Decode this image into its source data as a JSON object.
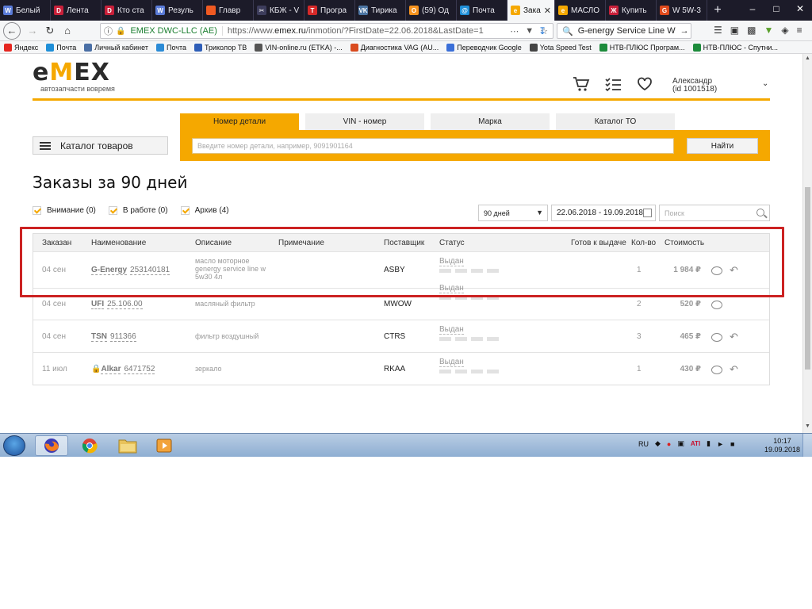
{
  "browser": {
    "tabs": [
      {
        "label": "Белый",
        "color": "#5a7bd8",
        "glyph": "W"
      },
      {
        "label": "Лента",
        "color": "#c8203a",
        "glyph": "D"
      },
      {
        "label": "Кто ста",
        "color": "#c8203a",
        "glyph": "D"
      },
      {
        "label": "Резуль",
        "color": "#5a7bd8",
        "glyph": "W"
      },
      {
        "label": "Главр",
        "color": "#f05a22",
        "glyph": ""
      },
      {
        "label": "КБЖ - V",
        "color": "#3d3d5c",
        "glyph": "✂"
      },
      {
        "label": "Програ",
        "color": "#d62929",
        "glyph": "T"
      },
      {
        "label": "Тирика",
        "color": "#4c75a3",
        "glyph": "VK"
      },
      {
        "label": "(59) Од",
        "color": "#f7931e",
        "glyph": "O"
      },
      {
        "label": "Почта",
        "color": "#1f8fd8",
        "glyph": "@"
      },
      {
        "label": "Заказ",
        "color": "#f5a800",
        "glyph": "e",
        "active": true
      },
      {
        "label": "МАСЛО",
        "color": "#f5a800",
        "glyph": "e"
      },
      {
        "label": "Купить",
        "color": "#c8203a",
        "glyph": "Ж"
      },
      {
        "label": "W 5W-3",
        "color": "#e04a1c",
        "glyph": "G"
      }
    ],
    "new_tab": "+",
    "url": {
      "site_label": "EMEX DWC-LLC (AE)",
      "prefix": "https://www.",
      "domain": "emex.ru",
      "path": "/inmotion/?FirstDate=22.06.2018&LastDate=1"
    },
    "search_value": "G-energy Service Line W",
    "bookmarks": [
      {
        "label": "Яндекс",
        "color": "#e52620"
      },
      {
        "label": "Почта",
        "color": "#1f8fd8"
      },
      {
        "label": "Личный кабинет",
        "color": "#4a6fa5"
      },
      {
        "label": "Почта",
        "color": "#2b8bd6"
      },
      {
        "label": "Триколор ТВ",
        "color": "#2e5eb8"
      },
      {
        "label": "VIN-online.ru (ETKA) -...",
        "color": "#555"
      },
      {
        "label": "Диагностика VAG (AU...",
        "color": "#d94a1e"
      },
      {
        "label": "Переводчик Google",
        "color": "#3a6fd8"
      },
      {
        "label": "Yota Speed Test",
        "color": "#444"
      },
      {
        "label": "НТВ-ПЛЮС Програм...",
        "color": "#1c8b3b"
      },
      {
        "label": "НТВ-ПЛЮС - Спутни...",
        "color": "#1c8b3b"
      }
    ]
  },
  "site": {
    "logo_parts": [
      "e",
      "M",
      "E",
      "X"
    ],
    "tagline": "автозапчасти вовремя",
    "accent": "#f5a800",
    "user_name": "Александр",
    "user_id": "(id 1001518)",
    "catalog_label": "Каталог товаров",
    "search_tabs": [
      "Номер детали",
      "VIN - номер",
      "Марка",
      "Каталог ТО"
    ],
    "search_placeholder": "Введите номер детали, например, 9091901164",
    "search_button": "Найти"
  },
  "orders": {
    "title": "Заказы за 90 дней",
    "filters": [
      {
        "label": "Внимание (0)"
      },
      {
        "label": "В работе (0)"
      },
      {
        "label": "Архив (4)"
      }
    ],
    "period": "90 дней",
    "date_range": "22.06.2018 - 19.09.2018",
    "search_placeholder": "Поиск",
    "columns": [
      "Заказан",
      "Наименование",
      "Описание",
      "Примечание",
      "Поставщик",
      "Статус",
      "Готов к выдаче",
      "Кол-во",
      "Стоимость"
    ],
    "rows": [
      {
        "date": "04 сен",
        "brand": "G-Energy",
        "part": "253140181",
        "lock": false,
        "desc": "масло моторное genergy service line w 5w30 4л",
        "supplier": "ASBY",
        "status": "Выдан",
        "qty": "1",
        "cost": "1 984 ₽",
        "return": true
      },
      {
        "date": "04 сен",
        "brand": "UFI",
        "part": "25.106.00",
        "lock": false,
        "desc": "масляный фильтр",
        "supplier": "MWOW",
        "status": "Выдан",
        "qty": "2",
        "cost": "520 ₽",
        "return": false
      },
      {
        "date": "04 сен",
        "brand": "TSN",
        "part": "911366",
        "lock": false,
        "desc": "фильтр воздушный",
        "supplier": "CTRS",
        "status": "Выдан",
        "qty": "3",
        "cost": "465 ₽",
        "return": true
      },
      {
        "date": "11 июл",
        "brand": "Alkar",
        "part": "6471752",
        "lock": true,
        "desc": "зеркало",
        "supplier": "RKAA",
        "status": "Выдан",
        "qty": "1",
        "cost": "430 ₽",
        "return": true
      }
    ]
  },
  "taskbar": {
    "lang": "RU",
    "time": "10:17",
    "date": "19.09.2018"
  }
}
